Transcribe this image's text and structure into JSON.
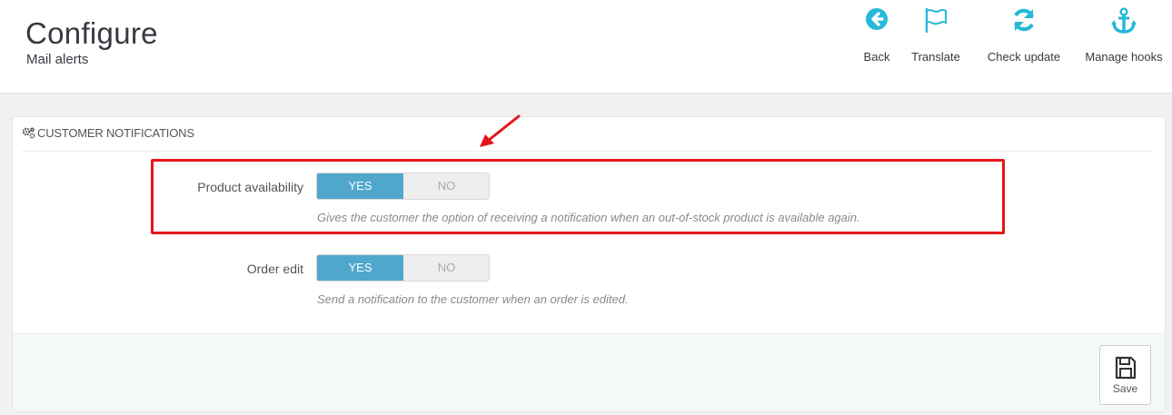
{
  "header": {
    "title": "Configure",
    "subtitle": "Mail alerts"
  },
  "toolbar": {
    "buttons": [
      {
        "label": "Back",
        "icon": "back-arrow-icon"
      },
      {
        "label": "Translate",
        "icon": "flag-icon"
      },
      {
        "label": "Check update",
        "icon": "refresh-icon"
      },
      {
        "label": "Manage hooks",
        "icon": "anchor-icon"
      }
    ]
  },
  "panel": {
    "heading": "CUSTOMER NOTIFICATIONS",
    "heading_icon": "cogs-icon",
    "fields": [
      {
        "label": "Product availability",
        "yes_label": "YES",
        "no_label": "NO",
        "value": "YES",
        "help": "Gives the customer the option of receiving a notification when an out-of-stock product is available again."
      },
      {
        "label": "Order edit",
        "yes_label": "YES",
        "no_label": "NO",
        "value": "YES",
        "help": "Send a notification to the customer when an order is edited."
      }
    ],
    "save_label": "Save"
  },
  "colors": {
    "accent": "#25b9d7",
    "switch_on": "#4fa7cc",
    "highlight": "#e4151b"
  }
}
